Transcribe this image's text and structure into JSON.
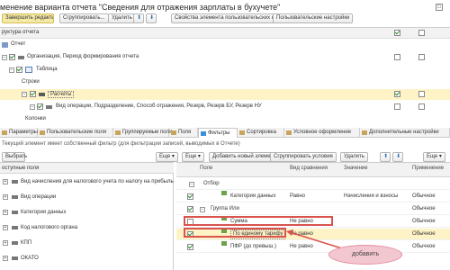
{
  "window": {
    "title": "менение варианта отчета \"Сведения для отражения зарплаты в бухучете\"",
    "close_glyph": "□"
  },
  "toolbar": {
    "finish": "Завершить редактирование",
    "group": "Сгруппировать...",
    "delete": "Удалить",
    "up": "⬆",
    "down": "⬇",
    "props": "Свойства элемента пользовательских настроек",
    "user_settings": "Пользовательские настройки"
  },
  "structure": {
    "header": "руктура отчета",
    "rows": [
      {
        "label": "Отчет"
      },
      {
        "label": "Организация, Период формирования отчета"
      },
      {
        "label": "Таблица"
      },
      {
        "label": "Строки"
      },
      {
        "label": "Расчеты"
      },
      {
        "label": "Вид операции, Подразделение, Способ отражения, Резерв, Резерв БУ, Резерв НУ"
      },
      {
        "label": "Колонки"
      }
    ]
  },
  "tabs": [
    {
      "label": "Параметры"
    },
    {
      "label": "Пользовательские поля"
    },
    {
      "label": "Группируемые поля"
    },
    {
      "label": "Поля"
    },
    {
      "label": "Фильтры"
    },
    {
      "label": "Сортировка"
    },
    {
      "label": "Условное оформление"
    },
    {
      "label": "Дополнительные настройки"
    }
  ],
  "info_text": "Текущий элемент имеет собственный фильтр (для фильтрации записей, выводимых в Отчете)",
  "left_toolbar": {
    "select": "Выбрать",
    "more": "Еще ▾"
  },
  "right_toolbar": {
    "more1": "Еще ▾",
    "add_new": "Добавить новый элемент",
    "group_conditions": "Сгруппировать условия",
    "delete": "Удалить",
    "up": "⬆",
    "down": "⬇",
    "more2": "Еще ▾"
  },
  "available_fields": {
    "header": "оступные поля",
    "items": [
      {
        "label": "Вид начисления для налогового учета по налогу на прибыль"
      },
      {
        "label": "Вид операции"
      },
      {
        "label": "Категория данных"
      },
      {
        "label": "Код налогового органа"
      },
      {
        "label": "КПП"
      },
      {
        "label": "ОКАТО"
      }
    ]
  },
  "filter_table": {
    "columns": {
      "field": "Поле",
      "comparison": "Вид сравнения",
      "value": "Значение",
      "usage": "Применение"
    },
    "rows": [
      {
        "field": "Отбор",
        "comparison": "",
        "value": "",
        "usage": ""
      },
      {
        "field": "Категория данных",
        "comparison": "Равно",
        "value": "Начисления и взносы",
        "usage": "Обычное"
      },
      {
        "field": "Группа Или",
        "comparison": "",
        "value": "",
        "usage": "Обычное"
      },
      {
        "field": "Сумма",
        "comparison": "Не равно",
        "value": "",
        "usage": "Обычное"
      },
      {
        "field": "По единому тарифу",
        "comparison": "Не равно",
        "value": "",
        "usage": "Обычное"
      },
      {
        "field": "ПФР (до превыш.)",
        "comparison": "Не равно",
        "value": "",
        "usage": "Обычное"
      }
    ]
  },
  "annotation": {
    "text": "добавить"
  }
}
